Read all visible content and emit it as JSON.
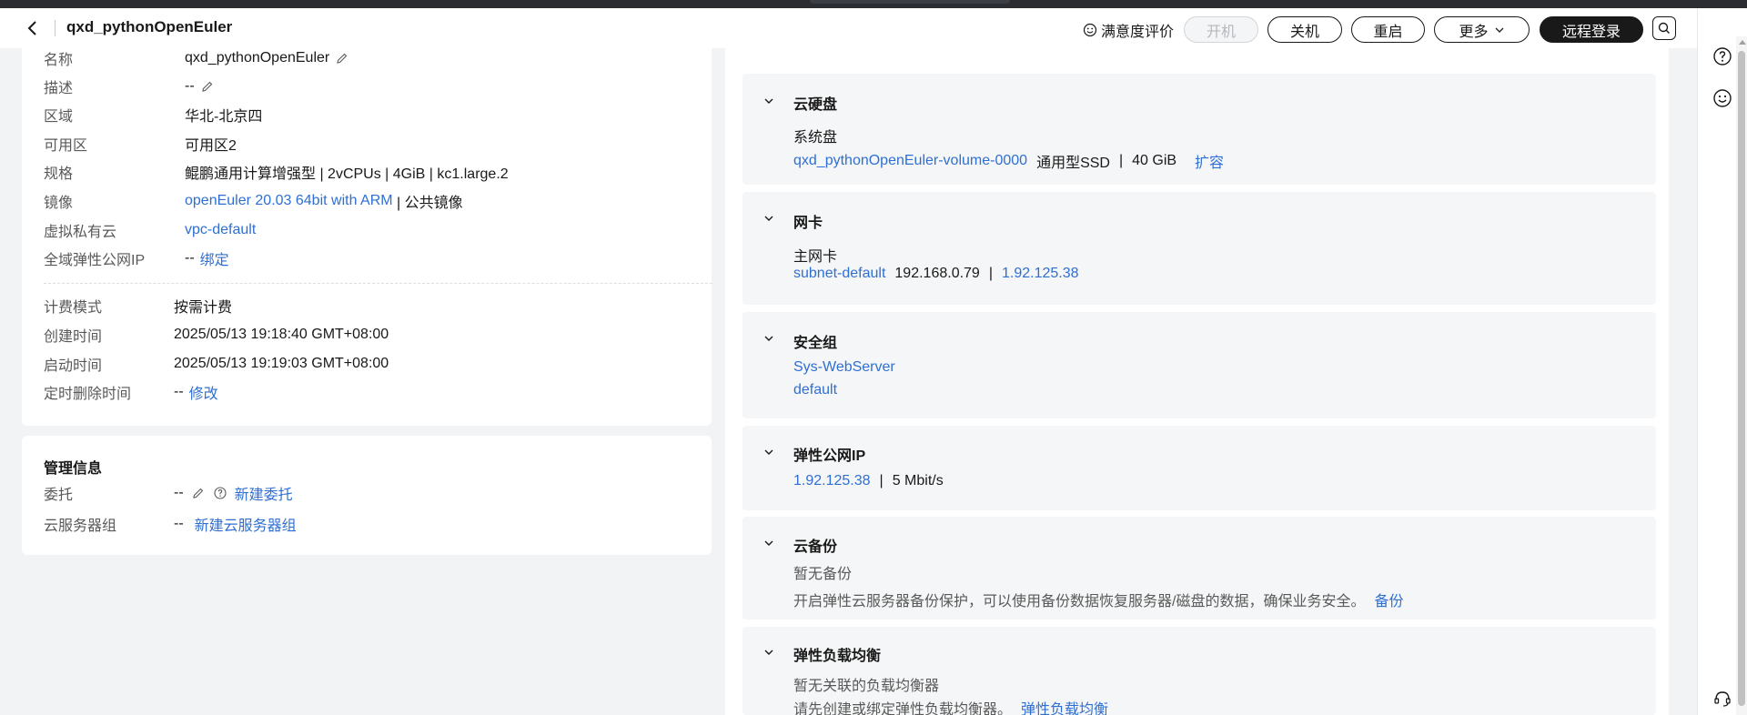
{
  "header": {
    "title": "qxd_pythonOpenEuler",
    "satisfaction_label": "满意度评价",
    "buttons": {
      "power_on": "开机",
      "shutdown": "关机",
      "restart": "重启",
      "more": "更多",
      "remote_login": "远程登录"
    }
  },
  "basic_info": {
    "rows": [
      {
        "label": "名称",
        "value": "qxd_pythonOpenEuler"
      },
      {
        "label": "描述",
        "value": "--"
      },
      {
        "label": "区域",
        "value": "华北-北京四"
      },
      {
        "label": "可用区",
        "value": "可用区2"
      },
      {
        "label": "规格",
        "value": "鲲鹏通用计算增强型 | 2vCPUs | 4GiB | kc1.large.2"
      },
      {
        "label": "镜像",
        "value": "openEuler 20.03 64bit with ARM",
        "value_suffix": " | 公共镜像"
      },
      {
        "label": "虚拟私有云",
        "value": "vpc-default"
      },
      {
        "label": "全域弹性公网IP",
        "value": "--",
        "link": "绑定"
      }
    ],
    "billing_rows": [
      {
        "label": "计费模式",
        "value": "按需计费"
      },
      {
        "label": "创建时间",
        "value": "2025/05/13 19:18:40 GMT+08:00"
      },
      {
        "label": "启动时间",
        "value": "2025/05/13 19:19:03 GMT+08:00"
      },
      {
        "label": "定时删除时间",
        "value": "--",
        "link": "修改"
      }
    ]
  },
  "management": {
    "title": "管理信息",
    "rows": [
      {
        "label": "委托",
        "value": "--",
        "link": "新建委托"
      },
      {
        "label": "云服务器组",
        "value": "--",
        "link": "新建云服务器组"
      }
    ]
  },
  "resources": {
    "disk": {
      "title": "云硬盘",
      "sub": "系统盘",
      "volume": "qxd_pythonOpenEuler-volume-0000",
      "type": "通用型SSD",
      "size": "40 GiB",
      "expand": "扩容",
      "sep": "|"
    },
    "nic": {
      "title": "网卡",
      "sub": "主网卡",
      "subnet": "subnet-default",
      "private_ip": "192.168.0.79",
      "sep": "|",
      "public_ip": "1.92.125.38"
    },
    "security_group": {
      "title": "安全组",
      "items": [
        "Sys-WebServer",
        "default"
      ]
    },
    "eip": {
      "title": "弹性公网IP",
      "ip": "1.92.125.38",
      "sep": "|",
      "bandwidth": "5 Mbit/s"
    },
    "backup": {
      "title": "云备份",
      "status": "暂无备份",
      "desc": "开启弹性云服务器备份保护，可以使用备份数据恢复服务器/磁盘的数据，确保业务安全。",
      "link": "备份"
    },
    "elb": {
      "title": "弹性负载均衡",
      "status": "暂无关联的负载均衡器",
      "desc": "请先创建或绑定弹性负载均衡器。",
      "link": "弹性负载均衡"
    }
  },
  "colors": {
    "link": "#2f6fd3",
    "primary_button": "#191919",
    "page_bg": "#f2f3f5"
  }
}
